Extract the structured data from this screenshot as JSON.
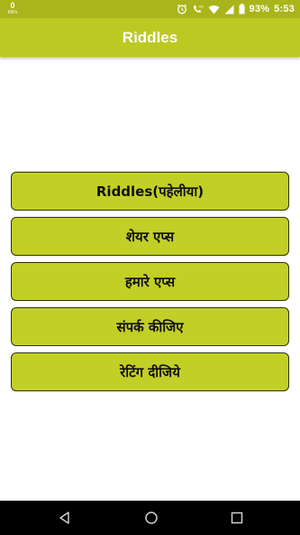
{
  "status_bar": {
    "net_speed": "0",
    "net_speed_unit": "KB/s",
    "battery": "93%",
    "time": "5:53",
    "icons": [
      "alarm-icon",
      "volte-call-icon",
      "wifi-icon",
      "signal-icon",
      "battery-icon"
    ]
  },
  "app_bar": {
    "title": "Riddles"
  },
  "menu": {
    "items": [
      {
        "label": "Riddles(पहेलीया)"
      },
      {
        "label": "शेयर एप्स"
      },
      {
        "label": "हमारे एप्स"
      },
      {
        "label": "संपर्क कीजिए"
      },
      {
        "label": "रेटिंग दीजिये"
      }
    ]
  },
  "nav_bar": {
    "icons": [
      "back-icon",
      "home-icon",
      "recents-icon"
    ]
  },
  "colors": {
    "status_bar": "#a9b51a",
    "app_bar": "#bdc923",
    "button_fill": "#c2cf26",
    "button_border": "#2f3306"
  }
}
